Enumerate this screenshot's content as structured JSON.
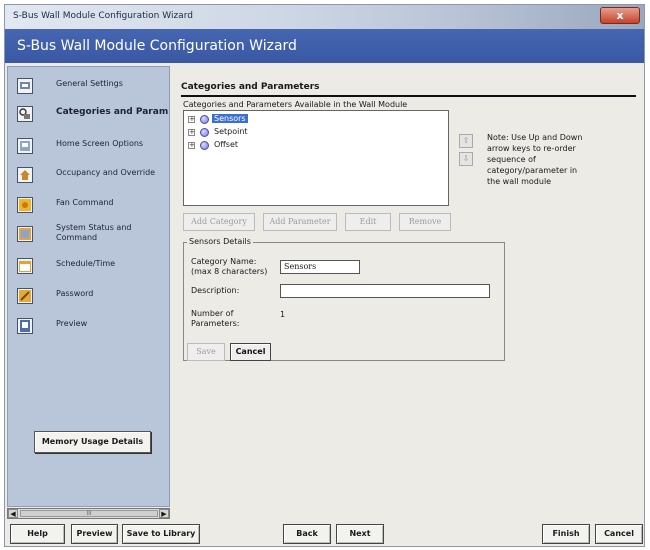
{
  "window": {
    "title": "S-Bus Wall Module Configuration Wizard",
    "close_symbol": "x",
    "heading": "S-Bus Wall Module Configuration Wizard"
  },
  "colors": {
    "banner": "#3a58a4",
    "sidebar": "#b9c6da",
    "selection": "#3d6ed1"
  },
  "sidebar": {
    "items": [
      {
        "label": "General Settings",
        "icon": "settings-icon"
      },
      {
        "label": "Categories and Parameters",
        "icon": "categories-icon",
        "active": true
      },
      {
        "label": "Home Screen Options",
        "icon": "home-screen-icon"
      },
      {
        "label": "Occupancy and Override",
        "icon": "occupancy-icon"
      },
      {
        "label": "Fan Command",
        "icon": "fan-icon"
      },
      {
        "label": "System Status and Command",
        "icon": "system-status-icon"
      },
      {
        "label": "Schedule/Time",
        "icon": "schedule-icon"
      },
      {
        "label": "Password",
        "icon": "password-icon"
      },
      {
        "label": "Preview",
        "icon": "preview-icon"
      }
    ],
    "memory_button": "Memory Usage Details",
    "scroll_thumb": "III"
  },
  "main": {
    "section_title": "Categories and Parameters",
    "list_caption": "Categories and Parameters Available in the Wall Module",
    "tree": [
      {
        "label": "Sensors",
        "selected": true
      },
      {
        "label": "Setpoint",
        "selected": false
      },
      {
        "label": "Offset",
        "selected": false
      }
    ],
    "up_arrow": "⇧",
    "down_arrow": "⇩",
    "note": "Note: Use Up and Down arrow keys to re-order sequence of category/parameter in the wall module",
    "buttons": {
      "add_category": "Add Category",
      "add_parameter": "Add Parameter",
      "edit": "Edit",
      "remove": "Remove"
    },
    "details": {
      "legend": "Sensors Details",
      "category_name_label": "Category Name:",
      "category_name_hint": "(max 8 characters)",
      "category_name_value": "Sensors",
      "description_label": "Description:",
      "description_value": "",
      "num_params_label": "Number of Parameters:",
      "num_params_value": "1",
      "save": "Save",
      "cancel": "Cancel"
    }
  },
  "footer": {
    "help": "Help",
    "preview": "Preview",
    "save_to_library": "Save to Library",
    "back": "Back",
    "next": "Next",
    "finish": "Finish",
    "cancel": "Cancel"
  }
}
